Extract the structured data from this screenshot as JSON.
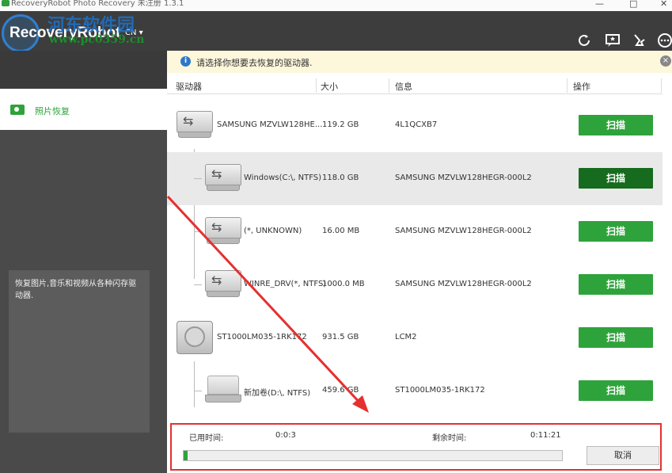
{
  "window": {
    "title": "RecoveryRobot Photo Recovery 未注册 1.3.1",
    "minimize": "—",
    "maximize": "□",
    "close": "✕"
  },
  "header": {
    "logo": "RecoveryRobot",
    "lang": "CN ▾",
    "watermark": "河东软件园",
    "watermark_url": "www.pc0359.cn",
    "icons": [
      "refresh-icon",
      "feedback-icon",
      "clean-icon",
      "more-icon"
    ]
  },
  "sidebar": {
    "item_label": "照片恢复",
    "description": "恢复图片,音乐和视频从各种闪存驱动器."
  },
  "notice": {
    "text": "请选择你想要去恢复的驱动器.",
    "info": "i",
    "close": "×"
  },
  "table": {
    "headers": [
      "驱动器",
      "大小",
      "信息",
      "操作"
    ],
    "rows": [
      {
        "name": "SAMSUNG MZVLW128HE...",
        "size": "119.2 GB",
        "info": "4L1QCXB7",
        "action": "扫描",
        "icon": "usb-icon",
        "child": false,
        "selected": false
      },
      {
        "name": "Windows(C:\\, NTFS)",
        "size": "118.0 GB",
        "info": "SAMSUNG MZVLW128HEGR-000L2",
        "action": "扫描",
        "icon": "usb-icon",
        "child": true,
        "selected": true
      },
      {
        "name": "(*, UNKNOWN)",
        "size": "16.00 MB",
        "info": "SAMSUNG MZVLW128HEGR-000L2",
        "action": "扫描",
        "icon": "usb-icon",
        "child": true,
        "selected": false
      },
      {
        "name": "WINRE_DRV(*, NTFS)",
        "size": "1000.0 MB",
        "info": "SAMSUNG MZVLW128HEGR-000L2",
        "action": "扫描",
        "icon": "usb-icon",
        "child": true,
        "selected": false
      },
      {
        "name": "ST1000LM035-1RK172",
        "size": "931.5 GB",
        "info": "LCM2",
        "action": "扫描",
        "icon": "hdd-icon",
        "child": false,
        "selected": false
      },
      {
        "name": "新加卷(D:\\, NTFS)",
        "size": "459.6 GB",
        "info": "ST1000LM035-1RK172",
        "action": "扫描",
        "icon": "drive-icon",
        "child": true,
        "selected": false
      }
    ]
  },
  "footer": {
    "elapsed_label": "已用时间:",
    "elapsed_value": "0:0:3",
    "remaining_label": "剩余时间:",
    "remaining_value": "0:11:21",
    "progress": 0.01,
    "cancel": "取消"
  },
  "colors": {
    "accent": "#2ea33b",
    "accent_dark": "#166b1e",
    "header_bg": "#3d3d3d",
    "annotation": "#e53030"
  }
}
